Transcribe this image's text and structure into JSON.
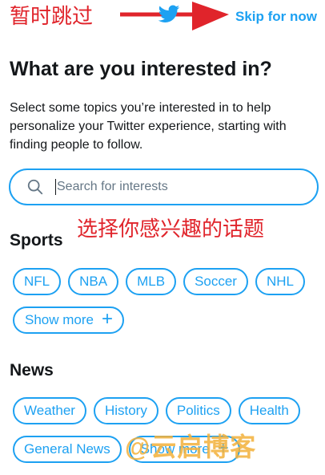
{
  "annotations": {
    "top": "暂时跳过",
    "middle": "选择你感兴趣的话题"
  },
  "header": {
    "skip_label": "Skip for now"
  },
  "title": "What are you interested in?",
  "description": "Select some topics you’re interested in to help personalize your Twitter experience, starting with finding people to follow.",
  "search": {
    "placeholder": "Search for interests"
  },
  "sections": {
    "sports": {
      "title": "Sports",
      "chips": [
        "NFL",
        "NBA",
        "MLB",
        "Soccer",
        "NHL"
      ],
      "more_label": "Show more"
    },
    "news": {
      "title": "News",
      "chips": [
        "Weather",
        "History",
        "Politics",
        "Health",
        "General News"
      ],
      "more_label": "Show more"
    }
  },
  "watermark": "@云启博客",
  "colors": {
    "accent": "#1da1f2",
    "annotation": "#e0242b",
    "watermark": "#f3b13a"
  }
}
